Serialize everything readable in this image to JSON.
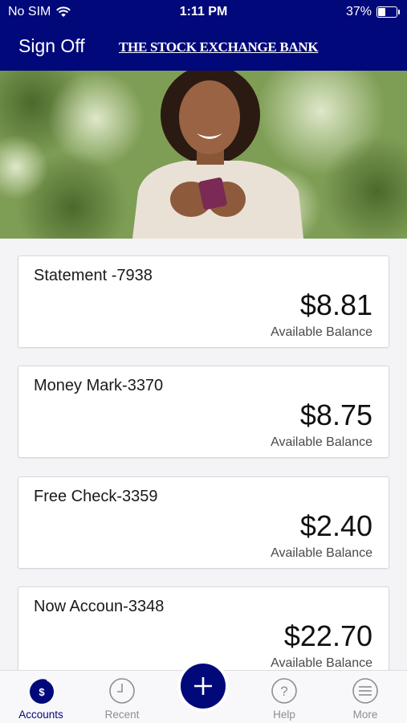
{
  "status_bar": {
    "carrier": "No SIM",
    "time": "1:11 PM",
    "battery_percent": "37%",
    "battery_level": 0.37
  },
  "header": {
    "sign_off": "Sign Off",
    "bank_name": "THE STOCK EXCHANGE BANK"
  },
  "accounts": [
    {
      "name": "Statement -7938",
      "amount": "$8.81",
      "label": "Available Balance"
    },
    {
      "name": "Money Mark-3370",
      "amount": "$8.75",
      "label": "Available Balance"
    },
    {
      "name": "Free Check-3359",
      "amount": "$2.40",
      "label": "Available Balance"
    },
    {
      "name": "Now Accoun-3348",
      "amount": "$22.70",
      "label": "Available Balance"
    }
  ],
  "tab_bar": {
    "items": [
      {
        "label": "Accounts",
        "icon": "dollar-circle-icon",
        "active": true
      },
      {
        "label": "Recent",
        "icon": "clock-icon",
        "active": false
      },
      {
        "label": "",
        "icon": "plus-icon",
        "active": false
      },
      {
        "label": "Help",
        "icon": "question-icon",
        "active": false
      },
      {
        "label": "More",
        "icon": "menu-icon",
        "active": false
      }
    ]
  },
  "colors": {
    "brand": "#00087a",
    "inactive_tab": "#8e8e93"
  }
}
